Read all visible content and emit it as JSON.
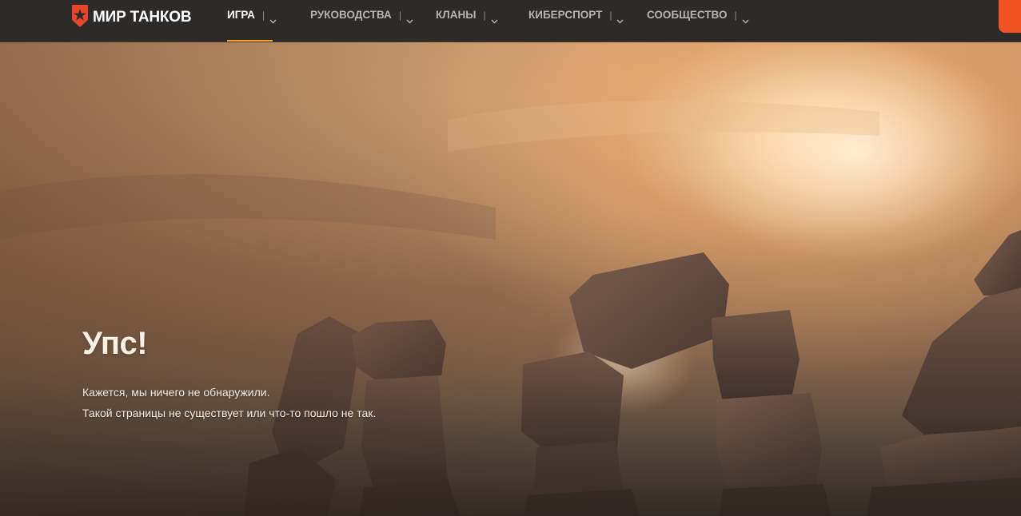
{
  "header": {
    "logo_text": "МИР ТАНКОВ",
    "nav": [
      {
        "label": "ИГРА",
        "active": true
      },
      {
        "label": "РУКОВОДСТВА",
        "active": false
      },
      {
        "label": "КЛАНЫ",
        "active": false
      },
      {
        "label": "КИБЕРСПОРТ",
        "active": false
      },
      {
        "label": "СООБЩЕСТВО",
        "active": false
      }
    ],
    "separator": "|"
  },
  "error": {
    "title": "Упс!",
    "line1": "Кажется, мы ничего не обнаружили.",
    "line2": "Такой страницы не существует или что-то пошло не так."
  },
  "colors": {
    "accent": "#f5a623",
    "cta": "#f25322",
    "header_bg": "#2d2b29",
    "logo_red": "#e8452c"
  },
  "icons": {
    "logo": "star-shield-icon",
    "nav_dropdown": "chevron-down-icon"
  }
}
